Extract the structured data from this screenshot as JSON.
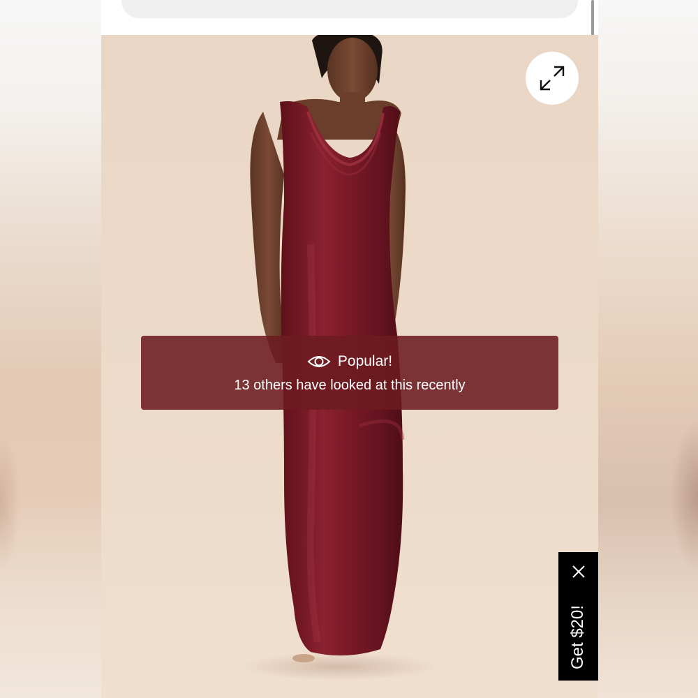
{
  "search": {
    "icon": "search-icon"
  },
  "product": {
    "image_alt": "Burgundy satin cowl neck maxi dress",
    "dress_color": "#7a1a24"
  },
  "expand": {
    "icon": "expand-arrows-icon"
  },
  "popular_banner": {
    "icon": "eye-icon",
    "title": "Popular!",
    "subtitle": "13 others have looked at this recently",
    "background": "#6c1b20"
  },
  "promo": {
    "label": "Get $20!",
    "close_icon": "close-icon"
  }
}
